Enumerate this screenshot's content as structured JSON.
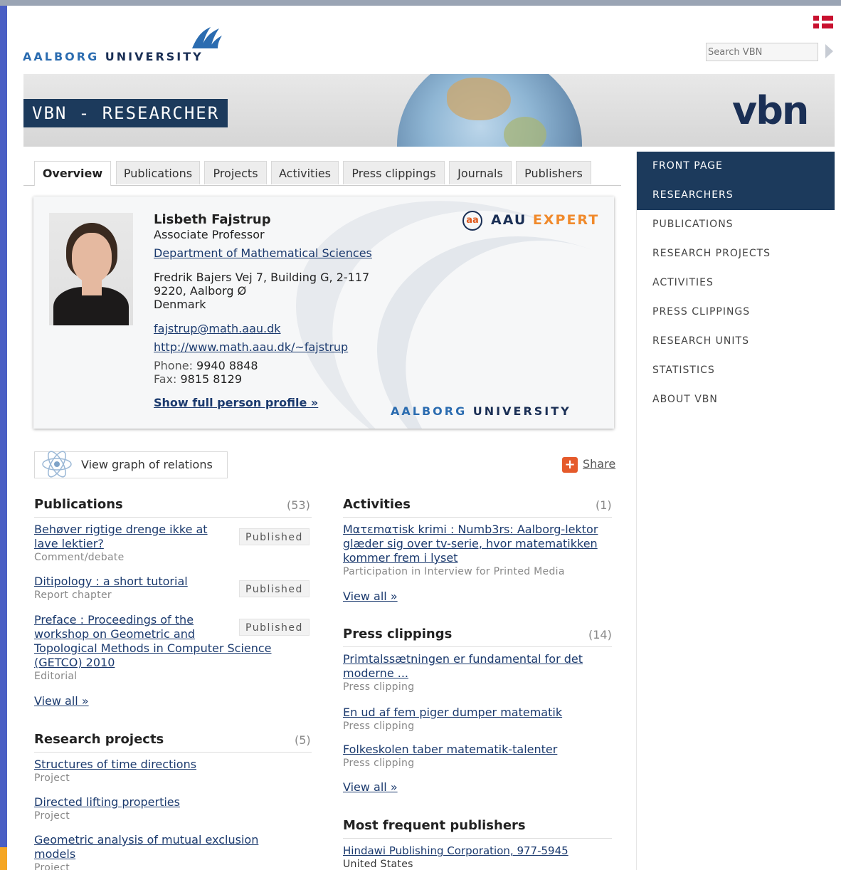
{
  "header": {
    "logo_word1": "AALBORG",
    "logo_word2": "UNIVERSITY",
    "search_placeholder": "Search VBN",
    "banner_title": "VBN - RESEARCHER",
    "banner_brand": "vbn"
  },
  "tabs": [
    "Overview",
    "Publications",
    "Projects",
    "Activities",
    "Press clippings",
    "Journals",
    "Publishers"
  ],
  "person": {
    "name": "Lisbeth Fajstrup",
    "title": "Associate Professor",
    "department": "Department of Mathematical Sciences",
    "address_line1": "Fredrik Bajers Vej 7, Building G, 2-117",
    "address_line2": "9220, Aalborg Ø",
    "address_line3": "Denmark",
    "email": "fajstrup@math.aau.dk",
    "website": "http://www.math.aau.dk/~fajstrup",
    "phone_label": "Phone:",
    "phone": "9940 8848",
    "fax_label": "Fax:",
    "fax": "9815 8129",
    "full_profile_link": "Show full person profile »",
    "expert_word1": "AAU",
    "expert_word2": "EXPERT",
    "expert_icon_text": "aa"
  },
  "actions": {
    "graph_label": "View graph of relations",
    "share_label": "Share"
  },
  "publications": {
    "heading": "Publications",
    "count": "(53)",
    "items": [
      {
        "title_line1": "Behøver rigtige drenge ikke at",
        "title_line2": "lave lektier?",
        "type": "Comment/debate",
        "status": "Published"
      },
      {
        "title_line1": "Ditipology : a short tutorial",
        "title_line2": "",
        "type": "Report chapter",
        "status": "Published"
      },
      {
        "title_line1": "Preface : Proceedings of the",
        "title_line2": "workshop on Geometric and",
        "title_line3": "Topological Methods in Computer Science",
        "title_line4": "(GETCO) 2010",
        "type": "Editorial",
        "status": "Published"
      }
    ],
    "view_all": "View all »"
  },
  "research_projects": {
    "heading": "Research projects",
    "count": "(5)",
    "items": [
      {
        "title_line1": "Structures of time directions",
        "type": "Project"
      },
      {
        "title_line1": "Directed lifting properties",
        "type": "Project"
      },
      {
        "title_line1": "Geometric analysis of mutual exclusion",
        "title_line2": "models",
        "type": "Project"
      }
    ]
  },
  "activities": {
    "heading": "Activities",
    "count": "(1)",
    "items": [
      {
        "title_line1": "Mατεmατisk krimi : Numb3rs: Aalborg-lektor",
        "title_line2": "glæder sig over tv-serie, hvor matematikken",
        "title_line3": "kommer frem i lyset",
        "type": "Participation in Interview for Printed Media"
      }
    ],
    "view_all": "View all »"
  },
  "press_clippings": {
    "heading": "Press clippings",
    "count": "(14)",
    "items": [
      {
        "title_line1": "Primtalssætningen er fundamental for det",
        "title_line2": "moderne ...",
        "type": "Press clipping"
      },
      {
        "title_line1": "En ud af fem piger dumper matematik",
        "type": "Press clipping"
      },
      {
        "title_line1": "Folkeskolen taber matematik-talenter",
        "type": "Press clipping"
      }
    ],
    "view_all": "View all »"
  },
  "publishers": {
    "heading": "Most frequent publishers",
    "items": [
      {
        "title_line1": "Hindawi Publishing Corporation, 977-5945",
        "country": "United States"
      }
    ]
  },
  "sidebar": {
    "items": [
      "FRONT PAGE",
      "RESEARCHERS",
      "PUBLICATIONS",
      "RESEARCH PROJECTS",
      "ACTIVITIES",
      "PRESS CLIPPINGS",
      "RESEARCH UNITS",
      "STATISTICS",
      "ABOUT VBN"
    ]
  },
  "colors": {
    "navy": "#1c3a5c",
    "link": "#1b3a6e",
    "accent_orange": "#f08a2c",
    "frame_blue": "#4a5fc4"
  }
}
